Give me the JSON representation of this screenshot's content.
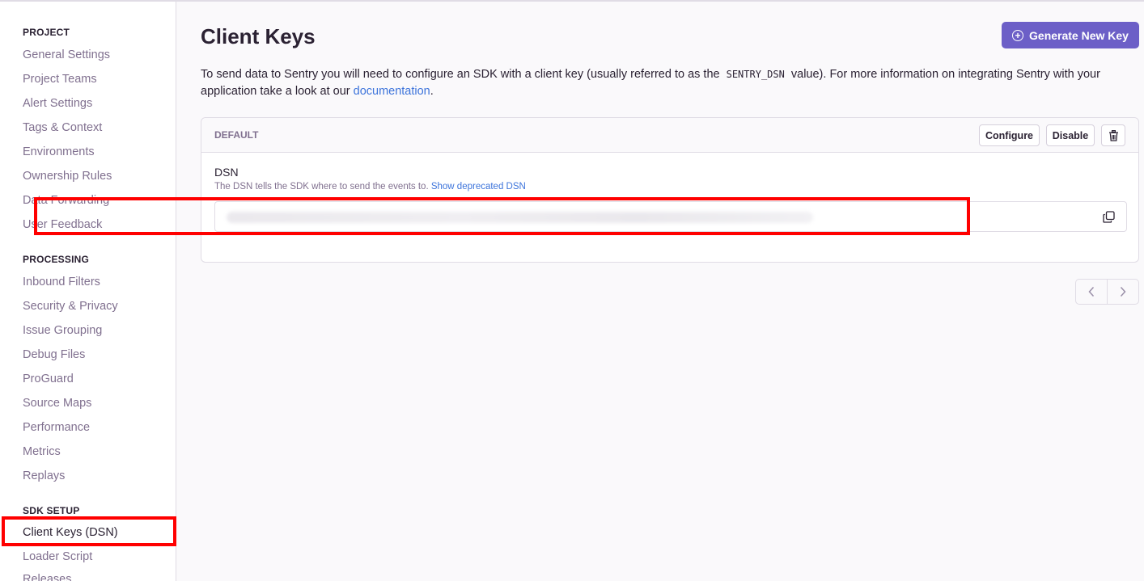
{
  "sidebar": {
    "sections": [
      {
        "title": "PROJECT"
      },
      {
        "title": "PROCESSING"
      },
      {
        "title": "SDK SETUP"
      }
    ],
    "project_items": [
      "General Settings",
      "Project Teams",
      "Alert Settings",
      "Tags & Context",
      "Environments",
      "Ownership Rules",
      "Data Forwarding",
      "User Feedback"
    ],
    "processing_items": [
      "Inbound Filters",
      "Security & Privacy",
      "Issue Grouping",
      "Debug Files",
      "ProGuard",
      "Source Maps",
      "Performance",
      "Metrics",
      "Replays"
    ],
    "sdk_items": [
      "Client Keys (DSN)",
      "Loader Script",
      "Releases"
    ],
    "active_item": "Client Keys (DSN)"
  },
  "header": {
    "title": "Client Keys",
    "generate_button": "Generate New Key"
  },
  "intro": {
    "text_before": "To send data to Sentry you will need to configure an SDK with a client key (usually referred to as the",
    "code": "SENTRY_DSN",
    "text_middle": "value). For more information on integrating Sentry with your application take a look at our",
    "link": "documentation",
    "text_after": "."
  },
  "key_panel": {
    "name": "DEFAULT",
    "configure_label": "Configure",
    "disable_label": "Disable",
    "dsn_label": "DSN",
    "dsn_help": "The DSN tells the SDK where to send the events to.",
    "dsn_help_link": "Show deprecated DSN"
  },
  "icons": {
    "generate": "plus-circle-icon",
    "delete": "trash-icon",
    "copy": "copy-icon",
    "prev": "chevron-left-icon",
    "next": "chevron-right-icon"
  },
  "colors": {
    "accent": "#6c5fc7",
    "link": "#3d74db",
    "highlight": "#ff0000"
  }
}
